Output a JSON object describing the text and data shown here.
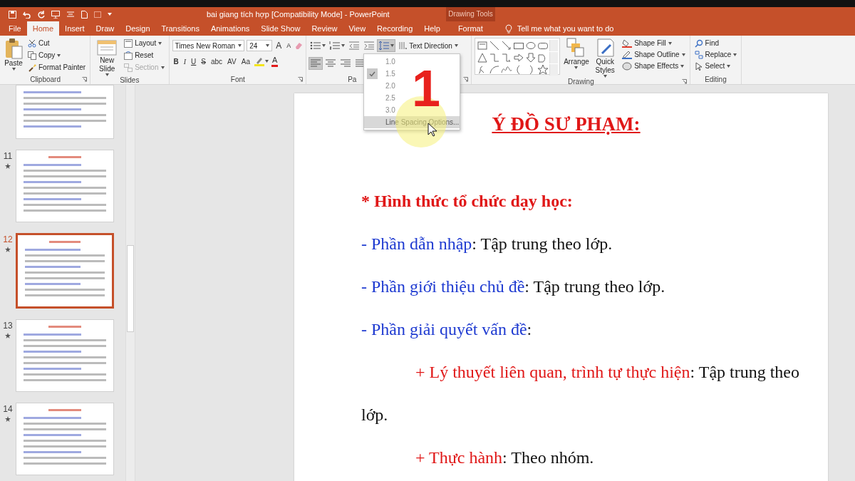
{
  "title_bar": {
    "title": "bai giang tích hợp [Compatibility Mode]  -  PowerPoint",
    "context_header": "Drawing Tools"
  },
  "tabs": [
    {
      "label": "File",
      "selected": false,
      "contextual": false
    },
    {
      "label": "Home",
      "selected": true,
      "contextual": false
    },
    {
      "label": "Insert",
      "selected": false,
      "contextual": false
    },
    {
      "label": "Draw",
      "selected": false,
      "contextual": false
    },
    {
      "label": "Design",
      "selected": false,
      "contextual": false
    },
    {
      "label": "Transitions",
      "selected": false,
      "contextual": false
    },
    {
      "label": "Animations",
      "selected": false,
      "contextual": false
    },
    {
      "label": "Slide Show",
      "selected": false,
      "contextual": false
    },
    {
      "label": "Review",
      "selected": false,
      "contextual": false
    },
    {
      "label": "View",
      "selected": false,
      "contextual": false
    },
    {
      "label": "Recording",
      "selected": false,
      "contextual": false
    },
    {
      "label": "Help",
      "selected": false,
      "contextual": false
    },
    {
      "label": "Format",
      "selected": false,
      "contextual": true
    }
  ],
  "tell_me": {
    "placeholder": "Tell me what you want to do"
  },
  "ribbon": [
    {
      "kind": "clipboard",
      "label": "Clipboard",
      "large": "Paste",
      "items": [
        {
          "label": "Cut",
          "disabled": false
        },
        {
          "label": "Copy",
          "disabled": false
        },
        {
          "label": "Format Painter",
          "disabled": false
        }
      ]
    },
    {
      "kind": "slides",
      "label": "Slides",
      "large": "New Slide",
      "items": [
        {
          "label": "Layout",
          "disabled": false
        },
        {
          "label": "Reset",
          "disabled": false
        },
        {
          "label": "Section",
          "disabled": true
        }
      ]
    },
    {
      "kind": "font",
      "label": "Font",
      "font_name": "Times New Roman",
      "font_size": "24",
      "size_buttons": [
        "A",
        "A"
      ],
      "format_buttons": [
        "B",
        "I",
        "U",
        "S",
        "abc",
        "AV",
        "Aa"
      ],
      "font_color": "A"
    },
    {
      "kind": "paragraph",
      "label": "Pa",
      "items": [
        {
          "label": "Text Direction",
          "disabled": false
        }
      ]
    },
    {
      "kind": "drawing",
      "label": "Drawing",
      "large": [
        "Arrange",
        "Quick Styles"
      ],
      "items": [
        {
          "label": "Shape Fill",
          "disabled": false
        },
        {
          "label": "Shape Outline",
          "disabled": false
        },
        {
          "label": "Shape Effects",
          "disabled": false
        }
      ]
    },
    {
      "kind": "editing",
      "label": "Editing",
      "items": [
        {
          "label": "Find",
          "disabled": false
        },
        {
          "label": "Replace",
          "disabled": false
        },
        {
          "label": "Select",
          "disabled": false
        }
      ]
    }
  ],
  "line_spacing_menu": [
    {
      "label": "1.0",
      "checked": false,
      "kind": "value"
    },
    {
      "label": "1.5",
      "checked": true,
      "kind": "value"
    },
    {
      "label": "2.0",
      "checked": false,
      "kind": "value"
    },
    {
      "label": "2.5",
      "checked": false,
      "kind": "value"
    },
    {
      "label": "3.0",
      "checked": false,
      "kind": "value"
    },
    {
      "label": "Line Spacing Options...",
      "checked": false,
      "kind": "command"
    }
  ],
  "annotation": {
    "number": "1"
  },
  "thumbnails": [
    {
      "selected": false
    },
    {
      "number": "11",
      "selected": false
    },
    {
      "number": "12",
      "selected": true
    },
    {
      "number": "13",
      "selected": false
    },
    {
      "number": "14",
      "selected": false
    }
  ],
  "slide": {
    "title": "Ý ĐỒ SƯ PHẠM:",
    "lines": [
      {
        "kind": "heading",
        "text": "* Hình thức tổ chức dạy học:"
      },
      {
        "kind": "item",
        "label": "- Phần dẫn nhập",
        "text": ": Tập trung theo lớp."
      },
      {
        "kind": "item",
        "label": "- Phần giới thiệu chủ đề",
        "text": ": Tập trung theo lớp."
      },
      {
        "kind": "item",
        "label": "- Phần giải quyết vấn đề",
        "text": ":"
      },
      {
        "kind": "sub",
        "label": "+ Lý thuyết liên quan, trình tự thực hiện",
        "text": ": Tập trung theo lớp."
      },
      {
        "kind": "sub",
        "label": "+ Thực hành",
        "text": ": Theo nhóm."
      }
    ]
  }
}
